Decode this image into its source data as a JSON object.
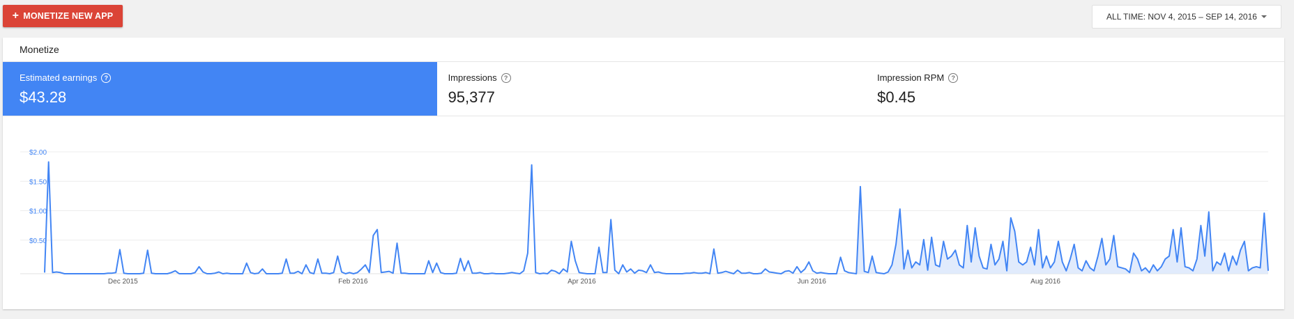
{
  "toolbar": {
    "monetize_button_label": "MONETIZE NEW APP",
    "plus_glyph": "+",
    "date_range_label": "ALL TIME: NOV 4, 2015 – SEP 14, 2016"
  },
  "card": {
    "title": "Monetize",
    "help_glyph": "?",
    "metrics": [
      {
        "label": "Estimated earnings",
        "value": "$43.28"
      },
      {
        "label": "Impressions",
        "value": "95,377"
      },
      {
        "label": "Impression RPM",
        "value": "$0.45"
      }
    ]
  },
  "colors": {
    "accent": "#4285f4",
    "primary_button": "#db4437",
    "area_fill": "#d9e6fb"
  },
  "chart_data": {
    "type": "line",
    "x_labels": [
      "Dec 2015",
      "Feb 2016",
      "Apr 2016",
      "Jun 2016",
      "Aug 2016"
    ],
    "y_ticks": [
      "$0.50",
      "$1.00",
      "$1.50",
      "$2.00"
    ],
    "ylim": [
      0,
      2.0
    ],
    "grid": true,
    "series": [
      {
        "values": [
          0.02,
          1.9,
          0.02,
          0.03,
          0.02,
          0.0,
          0.0,
          0.0,
          0.0,
          0.0,
          0.0,
          0.0,
          0.0,
          0.0,
          0.0,
          0.0,
          0.01,
          0.01,
          0.02,
          0.41,
          0.01,
          0.0,
          0.0,
          0.0,
          0.0,
          0.01,
          0.4,
          0.01,
          0.0,
          0.0,
          0.0,
          0.0,
          0.02,
          0.05,
          0.0,
          0.0,
          0.0,
          0.0,
          0.02,
          0.12,
          0.03,
          0.0,
          0.0,
          0.01,
          0.03,
          0.0,
          0.01,
          0.0,
          0.0,
          0.0,
          0.0,
          0.18,
          0.02,
          0.0,
          0.01,
          0.08,
          0.0,
          0.0,
          0.0,
          0.0,
          0.01,
          0.25,
          0.01,
          0.01,
          0.04,
          0.0,
          0.15,
          0.02,
          0.0,
          0.25,
          0.01,
          0.01,
          0.0,
          0.02,
          0.3,
          0.03,
          0.0,
          0.02,
          0.0,
          0.02,
          0.08,
          0.15,
          0.02,
          0.65,
          0.75,
          0.02,
          0.03,
          0.04,
          0.01,
          0.52,
          0.01,
          0.01,
          0.0,
          0.0,
          0.0,
          0.0,
          0.0,
          0.22,
          0.02,
          0.18,
          0.02,
          0.0,
          0.0,
          0.0,
          0.01,
          0.26,
          0.05,
          0.22,
          0.01,
          0.01,
          0.02,
          0.0,
          0.0,
          0.01,
          0.0,
          0.0,
          0.0,
          0.01,
          0.02,
          0.01,
          0.0,
          0.05,
          0.35,
          1.85,
          0.02,
          0.0,
          0.01,
          0.0,
          0.06,
          0.04,
          0.0,
          0.08,
          0.03,
          0.55,
          0.22,
          0.02,
          0.01,
          0.0,
          0.0,
          0.0,
          0.45,
          0.02,
          0.02,
          0.92,
          0.06,
          0.0,
          0.15,
          0.03,
          0.08,
          0.01,
          0.06,
          0.05,
          0.02,
          0.15,
          0.02,
          0.03,
          0.01,
          0.0,
          0.0,
          0.0,
          0.0,
          0.0,
          0.01,
          0.01,
          0.02,
          0.01,
          0.01,
          0.02,
          0.0,
          0.42,
          0.01,
          0.02,
          0.04,
          0.02,
          0.0,
          0.06,
          0.01,
          0.01,
          0.02,
          0.0,
          0.0,
          0.01,
          0.08,
          0.03,
          0.02,
          0.01,
          0.0,
          0.04,
          0.05,
          0.01,
          0.12,
          0.02,
          0.08,
          0.2,
          0.05,
          0.01,
          0.02,
          0.01,
          0.0,
          0.0,
          0.0,
          0.28,
          0.05,
          0.02,
          0.01,
          0.0,
          1.48,
          0.04,
          0.02,
          0.3,
          0.02,
          0.01,
          0.0,
          0.03,
          0.15,
          0.5,
          1.1,
          0.08,
          0.4,
          0.1,
          0.2,
          0.15,
          0.58,
          0.06,
          0.62,
          0.15,
          0.12,
          0.55,
          0.25,
          0.3,
          0.4,
          0.15,
          0.1,
          0.82,
          0.2,
          0.78,
          0.3,
          0.1,
          0.08,
          0.5,
          0.15,
          0.25,
          0.55,
          0.05,
          0.95,
          0.72,
          0.2,
          0.15,
          0.2,
          0.45,
          0.15,
          0.75,
          0.1,
          0.3,
          0.1,
          0.2,
          0.55,
          0.2,
          0.05,
          0.25,
          0.5,
          0.1,
          0.05,
          0.22,
          0.1,
          0.05,
          0.3,
          0.6,
          0.15,
          0.25,
          0.65,
          0.12,
          0.1,
          0.08,
          0.02,
          0.35,
          0.25,
          0.05,
          0.1,
          0.02,
          0.15,
          0.05,
          0.12,
          0.25,
          0.3,
          0.75,
          0.2,
          0.78,
          0.12,
          0.1,
          0.05,
          0.25,
          0.82,
          0.3,
          1.05,
          0.05,
          0.2,
          0.15,
          0.35,
          0.05,
          0.3,
          0.15,
          0.4,
          0.55,
          0.05,
          0.1,
          0.12,
          0.1,
          1.03,
          0.05
        ]
      }
    ]
  }
}
